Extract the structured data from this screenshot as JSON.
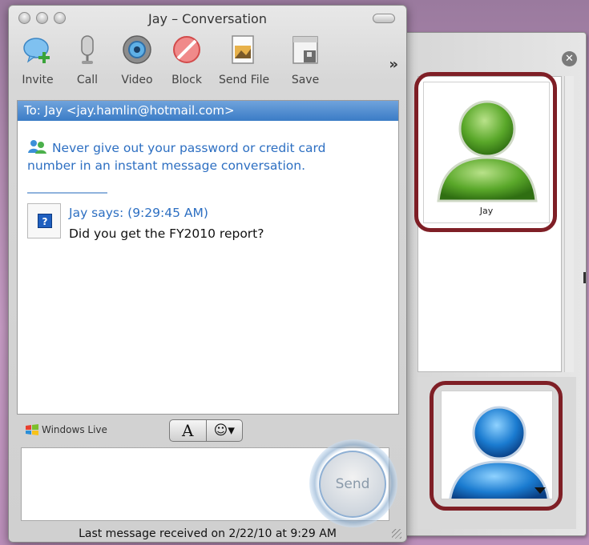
{
  "window": {
    "title": "Jay – Conversation"
  },
  "toolbar": {
    "items": [
      {
        "label": "Invite",
        "icon": "invite-icon"
      },
      {
        "label": "Call",
        "icon": "microphone-icon"
      },
      {
        "label": "Video",
        "icon": "webcam-icon"
      },
      {
        "label": "Block",
        "icon": "block-icon"
      },
      {
        "label": "Send File",
        "icon": "send-file-icon"
      },
      {
        "label": "Save",
        "icon": "save-icon"
      }
    ],
    "overflow": "»"
  },
  "chat": {
    "to": "To: Jay <jay.hamlin@hotmail.com>",
    "notice": "Never give out your password or credit card number in an instant message conversation.",
    "messages": [
      {
        "sender": "Jay says: (9:29:45 AM)",
        "text": "Did you get the FY2010 report?"
      }
    ]
  },
  "format": {
    "brand": "Windows Live",
    "font_button": "A",
    "emoticon_button": "☺▾"
  },
  "compose": {
    "send_label": "Send"
  },
  "status_bar": {
    "text": "Last message received on 2/22/10 at 9:29 AM"
  },
  "drawer": {
    "close": "✕",
    "contact": {
      "name": "Jay"
    }
  },
  "colors": {
    "highlight": "#7f1f26",
    "link_blue": "#2d6fc2",
    "to_bar": "#3b7cc6",
    "contact_avatar": "#5aa82a",
    "self_avatar": "#1a7bd0"
  }
}
